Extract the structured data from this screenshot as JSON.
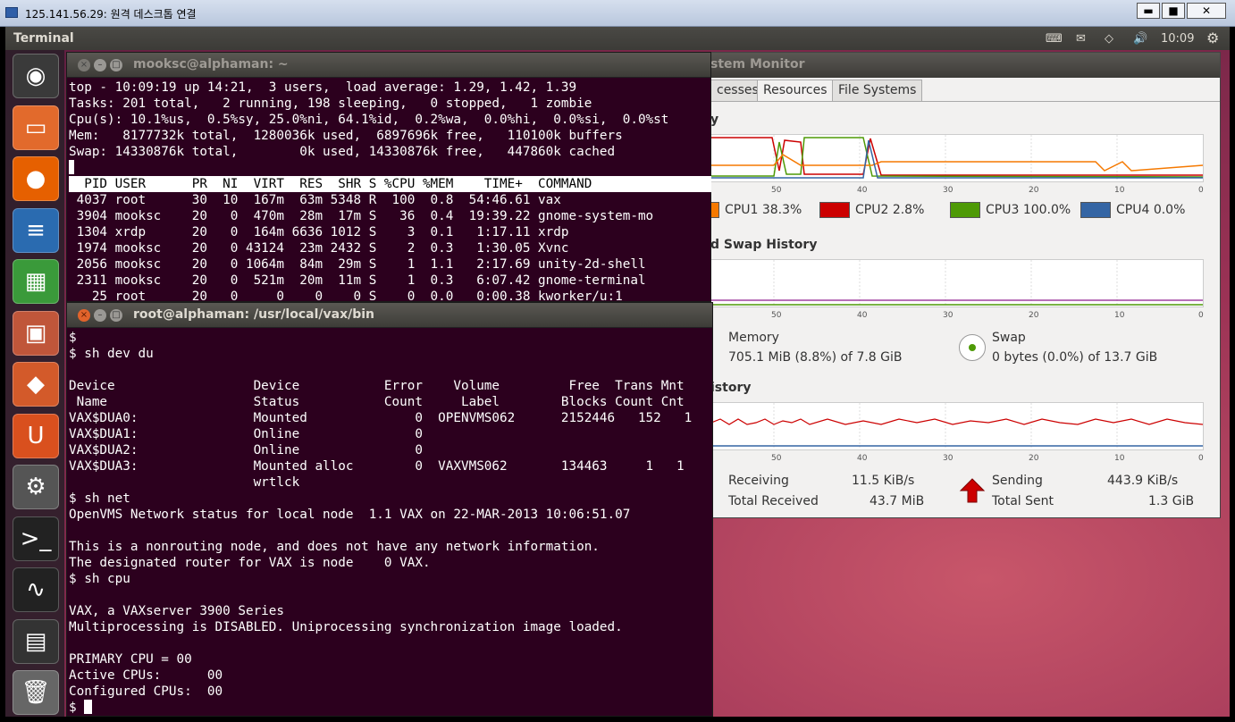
{
  "rdp": {
    "title": "125.141.56.29: 원격 데스크톱 연결",
    "min": "▬",
    "max": "■",
    "close": "✕"
  },
  "topbar": {
    "app_name": "Terminal",
    "clock": "10:09"
  },
  "launcher": [
    {
      "name": "dash-home-icon",
      "glyph": "◉"
    },
    {
      "name": "files-icon",
      "glyph": "▭"
    },
    {
      "name": "firefox-icon",
      "glyph": "●"
    },
    {
      "name": "writer-icon",
      "glyph": "≡"
    },
    {
      "name": "calc-icon",
      "glyph": "▦"
    },
    {
      "name": "impress-icon",
      "glyph": "▣"
    },
    {
      "name": "software-center-icon",
      "glyph": "◆"
    },
    {
      "name": "ubuntu-one-icon",
      "glyph": "U"
    },
    {
      "name": "system-settings-icon",
      "glyph": "⚙"
    },
    {
      "name": "terminal-icon",
      "glyph": ">_"
    },
    {
      "name": "system-monitor-icon",
      "glyph": "∿"
    },
    {
      "name": "workspaces-icon",
      "glyph": "▤"
    },
    {
      "name": "trash-icon",
      "glyph": "🗑"
    }
  ],
  "colors": {
    "terminal_bg": "#2c001e",
    "cpu1": "#f57900",
    "cpu2": "#cc0000",
    "cpu3": "#4e9a06",
    "cpu4": "#3465a4",
    "send_arrow": "#cc0000"
  },
  "term_top": {
    "title": "mooksc@alphaman: ~",
    "lines": [
      "top - 10:09:19 up 14:21,  3 users,  load average: 1.29, 1.42, 1.39",
      "Tasks: 201 total,   2 running, 198 sleeping,   0 stopped,   1 zombie",
      "Cpu(s): 10.1%us,  0.5%sy, 25.0%ni, 64.1%id,  0.2%wa,  0.0%hi,  0.0%si,  0.0%st",
      "Mem:   8177732k total,  1280036k used,  6897696k free,   110100k buffers",
      "Swap: 14330876k total,        0k used, 14330876k free,   447860k cached"
    ],
    "header": "  PID USER      PR  NI  VIRT  RES  SHR S %CPU %MEM    TIME+  COMMAND",
    "rows": [
      " 4037 root      30  10  167m  63m 5348 R  100  0.8  54:46.61 vax",
      " 3904 mooksc    20   0  470m  28m  17m S   36  0.4  19:39.22 gnome-system-mo",
      " 1304 xrdp      20   0  164m 6636 1012 S    3  0.1   1:17.11 xrdp",
      " 1974 mooksc    20   0 43124  23m 2432 S    2  0.3   1:30.05 Xvnc",
      " 2056 mooksc    20   0 1064m  84m  29m S    1  1.1   2:17.69 unity-2d-shell",
      " 2311 mooksc    20   0  521m  20m  11m S    1  0.3   6:07.42 gnome-terminal",
      "   25 root      20   0     0    0    0 S    0  0.0   0:00.38 kworker/u:1"
    ]
  },
  "term_bottom": {
    "title": "root@alphaman: /usr/local/vax/bin",
    "lines": [
      "$",
      "$ sh dev du",
      "",
      "Device                  Device           Error    Volume         Free  Trans Mnt",
      " Name                   Status           Count     Label        Blocks Count Cnt",
      "VAX$DUA0:               Mounted              0  OPENVMS062      2152446   152   1",
      "VAX$DUA1:               Online               0",
      "VAX$DUA2:               Online               0",
      "VAX$DUA3:               Mounted alloc        0  VAXVMS062       134463     1   1",
      "                        wrtlck",
      "$ sh net",
      "OpenVMS Network status for local node  1.1 VAX on 22-MAR-2013 10:06:51.07",
      "",
      "This is a nonrouting node, and does not have any network information.",
      "The designated router for VAX is node    0 VAX.",
      "$ sh cpu",
      "",
      "VAX, a VAXserver 3900 Series",
      "Multiprocessing is DISABLED. Uniprocessing synchronization image loaded.",
      "",
      "PRIMARY CPU = 00",
      "Active CPUs:      00",
      "Configured CPUs:  00"
    ],
    "prompt": "$ "
  },
  "sysmon": {
    "title": "stem Monitor",
    "tabs": [
      "cesses",
      "Resources",
      "File Systems"
    ],
    "cpu_section": "y",
    "mem_section": "d Swap History",
    "net_section": "istory",
    "ticks": [
      "50",
      "40",
      "30",
      "20",
      "10",
      "0"
    ],
    "cpu_legend": [
      {
        "label": "CPU1 38.3%",
        "value": 38.3
      },
      {
        "label": "CPU2 2.8%",
        "value": 2.8
      },
      {
        "label": "CPU3 100.0%",
        "value": 100.0
      },
      {
        "label": "CPU4 0.0%",
        "value": 0.0
      }
    ],
    "memory": {
      "label": "Memory",
      "value": "705.1 MiB (8.8%) of 7.8 GiB"
    },
    "swap": {
      "label": "Swap",
      "value": "0 bytes (0.0%) of 13.7 GiB"
    },
    "receiving": {
      "label": "Receiving",
      "value": "11.5 KiB/s"
    },
    "total_received": {
      "label": "Total Received",
      "value": "43.7 MiB"
    },
    "sending": {
      "label": "Sending",
      "value": "443.9 KiB/s"
    },
    "total_sent": {
      "label": "Total Sent",
      "value": "1.3 GiB"
    }
  }
}
